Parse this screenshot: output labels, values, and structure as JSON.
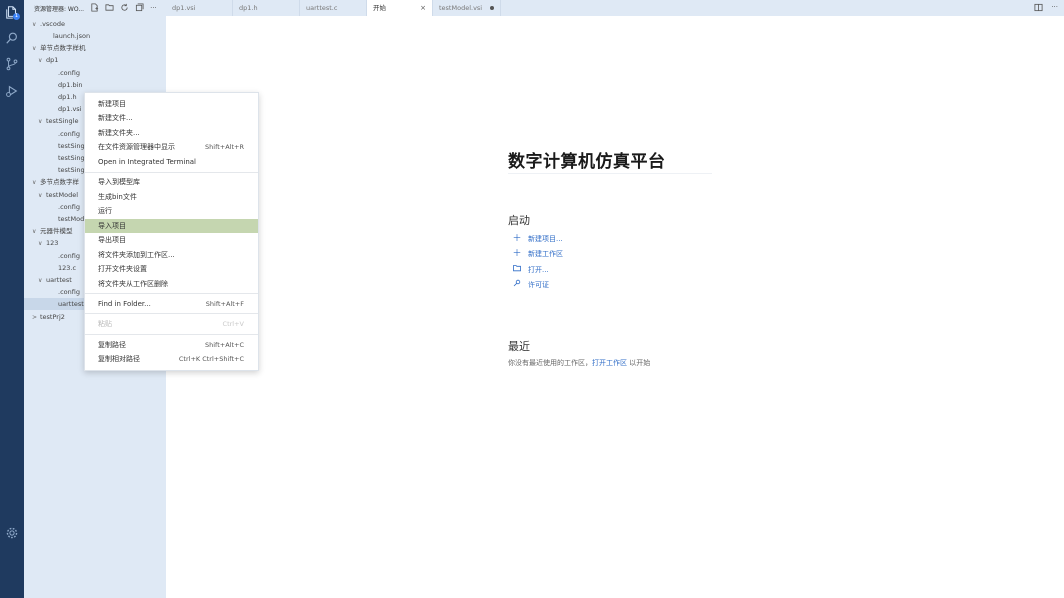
{
  "activity_bar": {
    "icons": [
      "explorer-icon",
      "search-icon",
      "source-control-icon",
      "run-debug-icon",
      "settings-gear-icon"
    ],
    "badge": "1"
  },
  "explorer": {
    "title": "资源管理器: WO...",
    "toolbar_icons": [
      "new-file-icon",
      "new-folder-icon",
      "refresh-icon",
      "collapse-all-icon",
      "more-icon"
    ],
    "more_label": "···",
    "tree": [
      {
        "label": ".vscode",
        "chev": "∨"
      },
      {
        "label": "launch.json",
        "chev": ""
      },
      {
        "label": "单节点数字样机",
        "chev": "∨"
      },
      {
        "label": "dp1",
        "chev": "∨"
      },
      {
        "label": ".config",
        "chev": ""
      },
      {
        "label": "dp1.bin",
        "chev": ""
      },
      {
        "label": "dp1.h",
        "chev": ""
      },
      {
        "label": "dp1.vsi",
        "chev": ""
      },
      {
        "label": "testSingle",
        "chev": "∨"
      },
      {
        "label": ".config",
        "chev": ""
      },
      {
        "label": "testSingle",
        "chev": ""
      },
      {
        "label": "testSingle",
        "chev": ""
      },
      {
        "label": "testSingle",
        "chev": ""
      },
      {
        "label": "多节点数字样",
        "chev": "∨"
      },
      {
        "label": "testModel",
        "chev": "∨"
      },
      {
        "label": ".config",
        "chev": ""
      },
      {
        "label": "testModel",
        "chev": ""
      },
      {
        "label": "元器件模型",
        "chev": "∨"
      },
      {
        "label": "123",
        "chev": "∨"
      },
      {
        "label": ".config",
        "chev": ""
      },
      {
        "label": "123.c",
        "chev": ""
      },
      {
        "label": "uarttest",
        "chev": "∨"
      },
      {
        "label": ".config",
        "chev": ""
      },
      {
        "label": "uarttest.c",
        "chev": ""
      },
      {
        "label": "testPrj2",
        "chev": ">"
      }
    ]
  },
  "tabs": [
    {
      "label": "dp1.vsi"
    },
    {
      "label": "dp1.h"
    },
    {
      "label": "uarttest.c"
    },
    {
      "label": "开始",
      "close": "×"
    },
    {
      "label": "testModel.vsi"
    }
  ],
  "tabbar_actions": {
    "split_icon": "split-editor-icon",
    "more": "···"
  },
  "context_menu": {
    "items": [
      {
        "label": "新建项目",
        "kbd": ""
      },
      {
        "label": "新建文件...",
        "kbd": ""
      },
      {
        "label": "新建文件夹...",
        "kbd": ""
      },
      {
        "label": "在文件资源管理器中显示",
        "kbd": "Shift+Alt+R"
      },
      {
        "label": "Open in Integrated Terminal",
        "kbd": ""
      },
      {
        "label": "导入到模型库",
        "kbd": ""
      },
      {
        "label": "生成bin文件",
        "kbd": ""
      },
      {
        "label": "运行",
        "kbd": ""
      },
      {
        "label": "导入项目",
        "kbd": ""
      },
      {
        "label": "导出项目",
        "kbd": ""
      },
      {
        "label": "将文件夹添加到工作区...",
        "kbd": ""
      },
      {
        "label": "打开文件夹设置",
        "kbd": ""
      },
      {
        "label": "将文件夹从工作区删除",
        "kbd": ""
      },
      {
        "label": "Find in Folder...",
        "kbd": "Shift+Alt+F"
      },
      {
        "label": "粘贴",
        "kbd": "Ctrl+V"
      },
      {
        "label": "复制路径",
        "kbd": "Shift+Alt+C"
      },
      {
        "label": "复制相对路径",
        "kbd": "Ctrl+K Ctrl+Shift+C"
      }
    ]
  },
  "welcome": {
    "title": "数字计算机仿真平台",
    "start_heading": "启动",
    "start_links": [
      {
        "icon": "plus-icon",
        "label": "新建项目..."
      },
      {
        "icon": "plus-icon",
        "label": "新建工作区"
      },
      {
        "icon": "folder-open-icon",
        "label": "打开..."
      },
      {
        "icon": "key-icon",
        "label": "许可证"
      }
    ],
    "recent_heading": "最近",
    "recent_text": "你没有最近使用的工作区，",
    "recent_link": "打开工作区",
    "recent_suffix": "以开始"
  }
}
